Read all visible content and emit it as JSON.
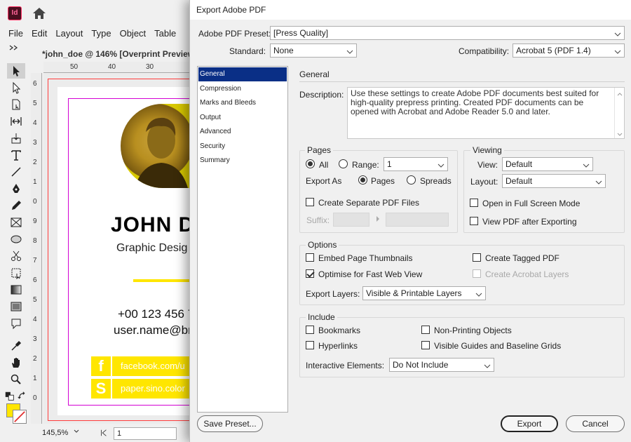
{
  "app": {
    "logo_text": "Id",
    "menu": [
      "File",
      "Edit",
      "Layout",
      "Type",
      "Object",
      "Table"
    ],
    "document_tab": "*john_doe @ 146% [Overprint Preview]",
    "ruler_top": [
      "50",
      "40",
      "30"
    ],
    "ruler_left": [
      "6",
      "5",
      "4",
      "3",
      "2",
      "1",
      "0",
      "9",
      "8",
      "7",
      "6",
      "5",
      "4",
      "3",
      "2",
      "1",
      "0"
    ],
    "zoom": "145,5%",
    "page": "1",
    "fill_color": "#ffe600",
    "card": {
      "name": "JOHN DO",
      "role": "Graphic Desig",
      "phone": "+00 123 456 7",
      "email": "user.name@br",
      "social": [
        {
          "icon": "f",
          "text": "facebook.com/u"
        },
        {
          "icon": "S",
          "text": "paper.sino.color"
        }
      ]
    }
  },
  "dialog": {
    "title": "Export Adobe PDF",
    "preset_label": "Adobe PDF Preset:",
    "preset_value": "[Press Quality]",
    "standard_label": "Standard:",
    "standard_value": "None",
    "compatibility_label": "Compatibility:",
    "compatibility_value": "Acrobat 5 (PDF 1.4)",
    "categories": [
      "General",
      "Compression",
      "Marks and Bleeds",
      "Output",
      "Advanced",
      "Security",
      "Summary"
    ],
    "selected_category": "General",
    "section_heading": "General",
    "description_label": "Description:",
    "description_text": "Use these settings to create Adobe PDF documents best suited for high-quality prepress printing.  Created PDF documents can be opened with Acrobat and Adobe Reader 5.0 and later.",
    "pages": {
      "title": "Pages",
      "all_label": "All",
      "range_label": "Range:",
      "range_value": "1",
      "export_as_label": "Export As",
      "pages_label": "Pages",
      "spreads_label": "Spreads",
      "separate_files_label": "Create Separate PDF Files",
      "suffix_label": "Suffix:"
    },
    "viewing": {
      "title": "Viewing",
      "view_label": "View:",
      "view_value": "Default",
      "layout_label": "Layout:",
      "layout_value": "Default",
      "full_screen_label": "Open in Full Screen Mode",
      "view_after_label": "View PDF after Exporting"
    },
    "options": {
      "title": "Options",
      "embed_thumbnails_label": "Embed Page Thumbnails",
      "optimise_label": "Optimise for Fast Web View",
      "tagged_pdf_label": "Create Tagged PDF",
      "acrobat_layers_label": "Create Acrobat Layers",
      "export_layers_label": "Export Layers:",
      "export_layers_value": "Visible & Printable Layers"
    },
    "include": {
      "title": "Include",
      "bookmarks_label": "Bookmarks",
      "hyperlinks_label": "Hyperlinks",
      "non_printing_label": "Non-Printing Objects",
      "visible_guides_label": "Visible Guides and Baseline Grids",
      "interactive_label": "Interactive Elements:",
      "interactive_value": "Do Not Include"
    },
    "save_preset_label": "Save Preset...",
    "export_label": "Export",
    "cancel_label": "Cancel",
    "accent_color": "#0a2f86"
  }
}
